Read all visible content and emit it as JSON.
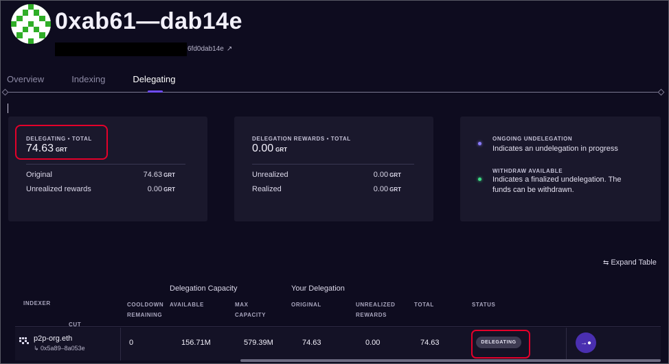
{
  "header": {
    "title": "0xab61—dab14e",
    "address_suffix": "6fd0dab14e",
    "external_link_glyph": "↗"
  },
  "tabs": [
    {
      "label": "Overview",
      "active": false
    },
    {
      "label": "Indexing",
      "active": false
    },
    {
      "label": "Delegating",
      "active": true
    }
  ],
  "summary": {
    "delegating": {
      "label": "DELEGATING • TOTAL",
      "total": "74.63",
      "unit": "GRT",
      "rows": [
        {
          "label": "Original",
          "value": "74.63",
          "unit": "GRT"
        },
        {
          "label": "Unrealized rewards",
          "value": "0.00",
          "unit": "GRT"
        }
      ]
    },
    "rewards": {
      "label": "DELEGATION REWARDS • TOTAL",
      "total": "0.00",
      "unit": "GRT",
      "rows": [
        {
          "label": "Unrealized",
          "value": "0.00",
          "unit": "GRT"
        },
        {
          "label": "Realized",
          "value": "0.00",
          "unit": "GRT"
        }
      ]
    },
    "legend": [
      {
        "title": "ONGOING UNDELEGATION",
        "desc": "Indicates an undelegation in progress",
        "color": "#8b7bff"
      },
      {
        "title": "WITHDRAW AVAILABLE",
        "desc_line1": "Indicates a finalized undelegation. The",
        "desc_line2": "funds can be withdrawn.",
        "color": "#3ddc84"
      }
    ]
  },
  "expand_table": {
    "label": "Expand Table",
    "icon": "expand-icon"
  },
  "table": {
    "groups": {
      "capacity": "Delegation Capacity",
      "your_delegation": "Your Delegation"
    },
    "headers": {
      "indexer": "INDEXER",
      "cut": "CUT",
      "cooldown_1": "COOLDOWN",
      "cooldown_2": "REMAINING",
      "available": "AVAILABLE",
      "max_1": "MAX",
      "max_2": "CAPACITY",
      "original": "ORIGINAL",
      "unrealized_1": "UNREALIZED",
      "unrealized_2": "REWARDS",
      "total": "TOTAL",
      "status": "STATUS"
    },
    "rows": [
      {
        "indexer_name": "p2p-org.eth",
        "indexer_addr": "↳ 0x5a89–8a053e",
        "cooldown": "0",
        "available": "156.71M",
        "max_capacity": "579.39M",
        "original": "74.63",
        "unrealized": "0.00",
        "total": "74.63",
        "status": "DELEGATING"
      }
    ]
  }
}
